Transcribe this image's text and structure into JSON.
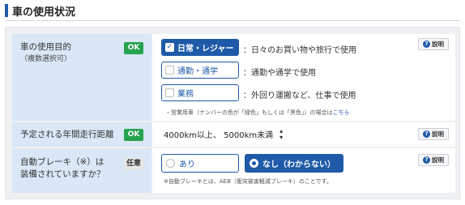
{
  "header": {
    "title": "車の使用状況"
  },
  "usage": {
    "label": "車の使用目的",
    "sublabel": "（複数選択可）",
    "badge": "OK",
    "options": [
      {
        "label": "日常・レジャー",
        "desc": "：日々のお買い物や旅行で使用",
        "checked": true
      },
      {
        "label": "通勤・通学",
        "desc": "：通勤や通学で使用",
        "checked": false
      },
      {
        "label": "業務",
        "desc": "：外回り運搬など、仕事で使用",
        "checked": false
      }
    ],
    "note": "・営業用車（ナンバーの色が「緑色」もしくは「黒色」）の場合は",
    "note_link": "こちら",
    "help": "説明"
  },
  "distance": {
    "label": "予定される年間走行距離",
    "badge": "OK",
    "selected": "4000km以上、 5000km未満",
    "help": "説明"
  },
  "brake": {
    "label_line1": "自動ブレーキ（※）は",
    "label_line2": "装備されていますか？",
    "badge": "任意",
    "options": [
      {
        "label": "あり",
        "selected": false
      },
      {
        "label": "なし（わからない）",
        "selected": true
      }
    ],
    "note": "※自動ブレーキとは、AEB（衝突被害軽減ブレーキ）のことです。",
    "help": "説明"
  },
  "colors": {
    "accent": "#1e5aa8",
    "ok": "#27a24f",
    "label_bg": "#d9e7f6"
  }
}
